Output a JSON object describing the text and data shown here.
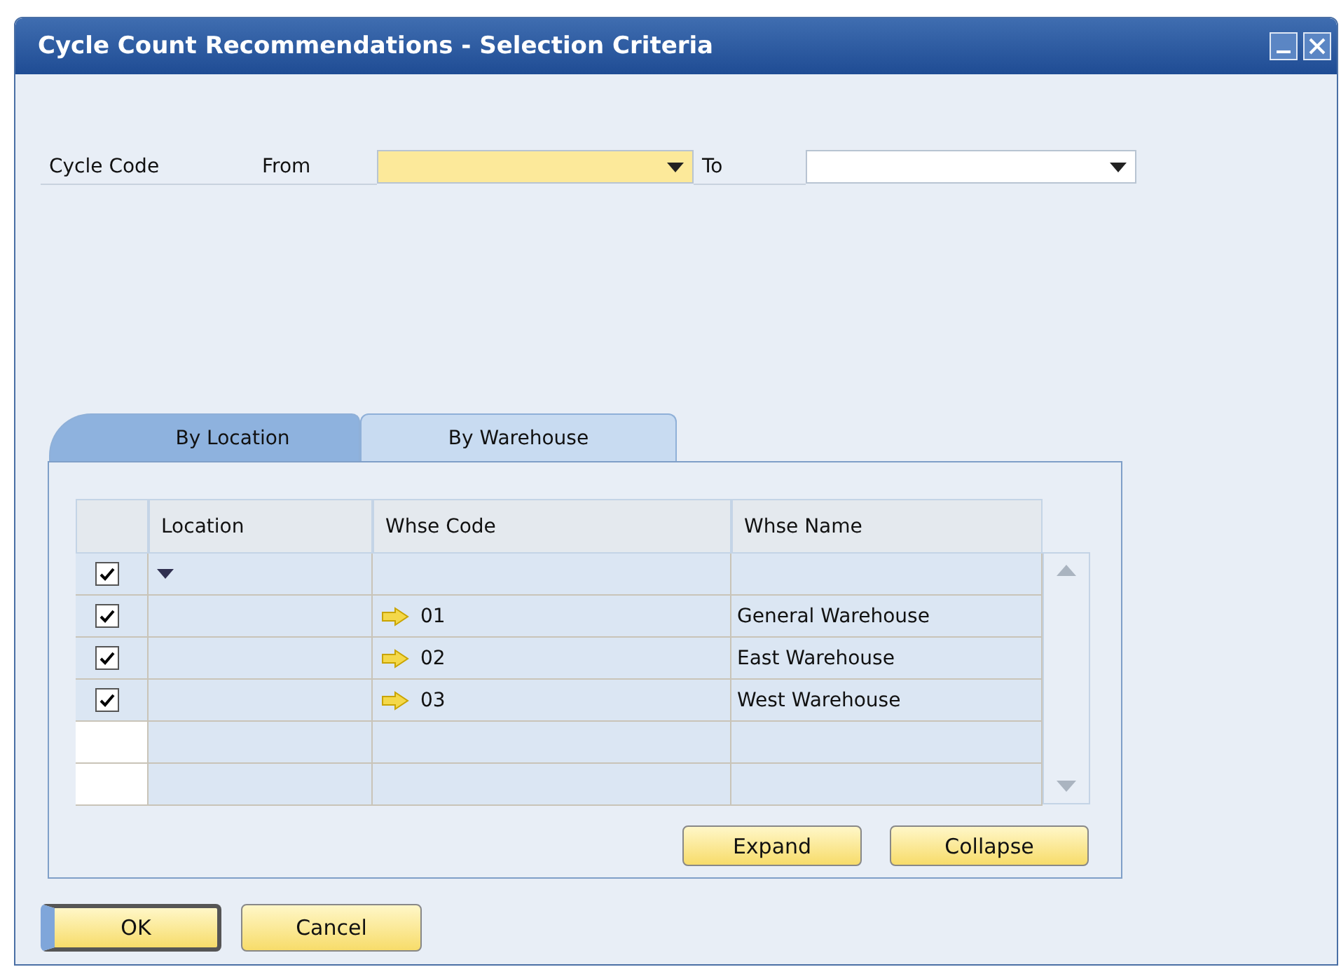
{
  "window": {
    "title": "Cycle Count Recommendations - Selection Criteria"
  },
  "criteria": {
    "label": "Cycle Code",
    "from_label": "From",
    "from_focused": true,
    "to_label": "To"
  },
  "tabs": [
    {
      "label": "By Location",
      "selected": true
    },
    {
      "label": "By Warehouse",
      "selected": false
    }
  ],
  "table": {
    "columns": [
      "Location",
      "Whse Code",
      "Whse Name"
    ],
    "rows": [
      {
        "kind": "filter",
        "checked": true
      },
      {
        "kind": "warehouse",
        "checked": true,
        "code": "01",
        "name": "General Warehouse"
      },
      {
        "kind": "warehouse",
        "checked": true,
        "code": "02",
        "name": "East Warehouse"
      },
      {
        "kind": "warehouse",
        "checked": true,
        "code": "03",
        "name": "West Warehouse"
      },
      {
        "kind": "empty"
      },
      {
        "kind": "empty"
      }
    ]
  },
  "panel_buttons": [
    "Expand",
    "Collapse"
  ],
  "buttons": [
    {
      "label": "OK",
      "default": true
    },
    {
      "label": "Cancel",
      "default": false
    }
  ]
}
